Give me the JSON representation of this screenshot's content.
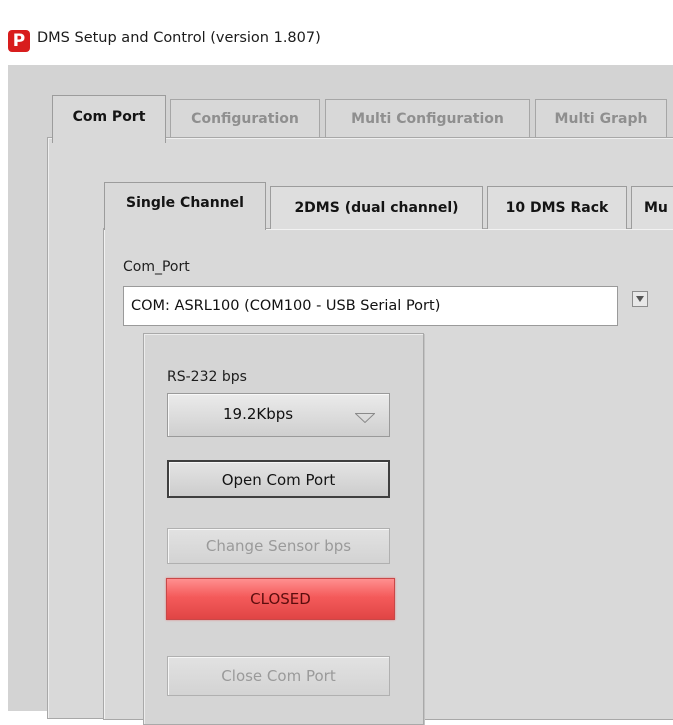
{
  "window": {
    "title": "DMS Setup and Control (version 1.807)",
    "logo_text": "P",
    "logo_color": "#d81d1d"
  },
  "outer_tabs": [
    {
      "label": "Com Port",
      "active": true
    },
    {
      "label": "Configuration",
      "active": false
    },
    {
      "label": "Multi Configuration",
      "active": false
    },
    {
      "label": "Multi Graph",
      "active": false
    }
  ],
  "inner_tabs": [
    {
      "label": "Single Channel",
      "active": true
    },
    {
      "label": "2DMS (dual channel)",
      "active": false
    },
    {
      "label": "10 DMS Rack",
      "active": false
    },
    {
      "label": "Mu",
      "active": false
    }
  ],
  "com_port": {
    "label": "Com_Port",
    "value": "COM: ASRL100  (COM100 - USB Serial Port)"
  },
  "serial": {
    "bps_label": "RS-232 bps",
    "bps_value": "19.2Kbps",
    "open_button": "Open Com Port",
    "change_button": "Change Sensor bps",
    "status": "CLOSED",
    "status_color": "#f45a5a",
    "close_button": "Close Com Port"
  }
}
